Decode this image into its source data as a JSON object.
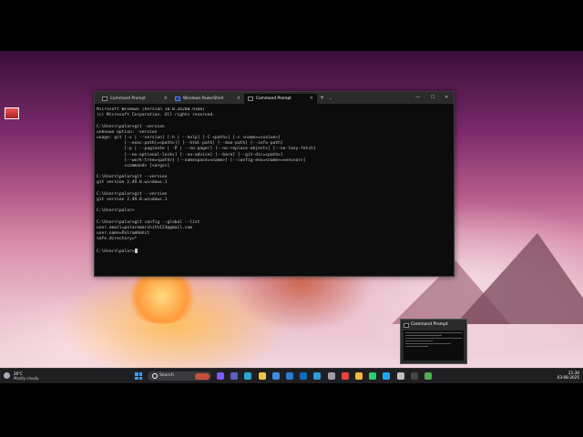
{
  "desktop": {
    "icon_label": ""
  },
  "terminal": {
    "tabs": [
      {
        "label": "Command Prompt",
        "active": false
      },
      {
        "label": "Windows PowerShell",
        "active": false
      },
      {
        "label": "Command Prompt",
        "active": true
      }
    ],
    "new_tab": "+",
    "tab_menu": "⌄",
    "minimize": "—",
    "maximize": "☐",
    "close": "✕",
    "lines": [
      "Microsoft Windows [Version 10.0.26200.9166]",
      "(c) Microsoft Corporation. All rights reserved.",
      "",
      "C:\\Users\\palar>git -version",
      "unknown option: -version",
      "usage: git [-v | --version] [-h | --help] [-C <path>] [-c <name>=<value>]",
      "           [--exec-path[=<path>]] [--html-path] [--man-path] [--info-path]",
      "           [-p | --paginate | -P | --no-pager] [--no-replace-objects] [--no-lazy-fetch]",
      "           [--no-optional-locks] [--no-advice] [--bare] [--git-dir=<path>]",
      "           [--work-tree=<path>] [--namespace=<name>] [--config-env=<name>=<envvar>]",
      "           <command> [<args>]",
      "",
      "C:\\Users\\palar>git --version",
      "git version 2.49.0.windows.1",
      "",
      "C:\\Users\\palar>git --version",
      "git version 2.49.0.windows.1",
      "",
      "C:\\Users\\palar>",
      "",
      "C:\\Users\\palar>git config --global --list",
      "user.email=palaramarshith123@gmail.com",
      "user.name=PalramHohit",
      "safe.directory=*",
      "",
      "C:\\Users\\palar>"
    ]
  },
  "preview": {
    "title": "Command Prompt"
  },
  "taskbar": {
    "weather_temp": "26°C",
    "weather_desc": "Mostly cloudy",
    "search_label": "Search",
    "clock_time": "21:30",
    "clock_date": "03-08-2025",
    "icons": [
      {
        "name": "copilot-icon",
        "color": "#7b5cff"
      },
      {
        "name": "teams-icon",
        "color": "#5b5fc7"
      },
      {
        "name": "edge-icon",
        "color": "#2fa6d6"
      },
      {
        "name": "explorer-icon",
        "color": "#f2c14e"
      },
      {
        "name": "store-icon",
        "color": "#3b8ee8"
      },
      {
        "name": "mail-icon",
        "color": "#2b7cd3"
      },
      {
        "name": "outlook-icon",
        "color": "#0f6cbd"
      },
      {
        "name": "photos-icon",
        "color": "#2c9fd9"
      },
      {
        "name": "settings-icon",
        "color": "#9aa0a6"
      },
      {
        "name": "chrome-icon",
        "color": "#e8453c"
      },
      {
        "name": "files-icon",
        "color": "#f5b942"
      },
      {
        "name": "whatsapp-icon",
        "color": "#25d366"
      },
      {
        "name": "vscode-icon",
        "color": "#22a7f0"
      },
      {
        "name": "gear-icon",
        "color": "#c0c0c0"
      },
      {
        "name": "terminal-icon",
        "color": "#444"
      },
      {
        "name": "chrome2-icon",
        "color": "#4caf50"
      }
    ]
  }
}
